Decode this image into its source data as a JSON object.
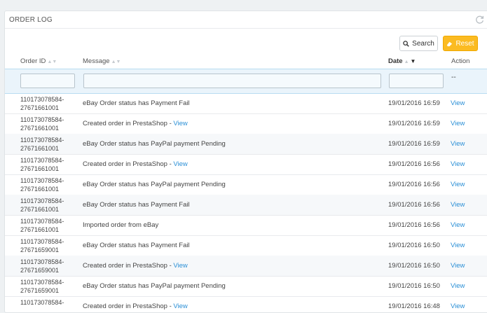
{
  "panel": {
    "title": "Order Log"
  },
  "toolbar": {
    "search_label": "Search",
    "reset_label": "Reset"
  },
  "columns": {
    "order_id": "Order ID",
    "message": "Message",
    "date": "Date",
    "action": "Action"
  },
  "filters": {
    "action_placeholder": "--"
  },
  "rows": [
    {
      "order_id": [
        "110173078584-",
        "27671661001"
      ],
      "message": "eBay Order status has Payment Fail",
      "link": "",
      "date": "19/01/2016 16:59",
      "action": "View"
    },
    {
      "order_id": [
        "110173078584-",
        "27671661001"
      ],
      "message": "Created order in PrestaShop - ",
      "link": "View",
      "date": "19/01/2016 16:59",
      "action": "View"
    },
    {
      "order_id": [
        "110173078584-",
        "27671661001"
      ],
      "message": "eBay Order status has PayPal payment Pending",
      "link": "",
      "date": "19/01/2016 16:59",
      "action": "View"
    },
    {
      "order_id": [
        "110173078584-",
        "27671661001"
      ],
      "message": "Created order in PrestaShop - ",
      "link": "View",
      "date": "19/01/2016 16:56",
      "action": "View"
    },
    {
      "order_id": [
        "110173078584-",
        "27671661001"
      ],
      "message": "eBay Order status has PayPal payment Pending",
      "link": "",
      "date": "19/01/2016 16:56",
      "action": "View"
    },
    {
      "order_id": [
        "110173078584-",
        "27671661001"
      ],
      "message": "eBay Order status has Payment Fail",
      "link": "",
      "date": "19/01/2016 16:56",
      "action": "View"
    },
    {
      "order_id": [
        "110173078584-",
        "27671661001"
      ],
      "message": "Imported order from eBay",
      "link": "",
      "date": "19/01/2016 16:56",
      "action": "View"
    },
    {
      "order_id": [
        "110173078584-",
        "27671659001"
      ],
      "message": "eBay Order status has Payment Fail",
      "link": "",
      "date": "19/01/2016 16:50",
      "action": "View"
    },
    {
      "order_id": [
        "110173078584-",
        "27671659001"
      ],
      "message": "Created order in PrestaShop - ",
      "link": "View",
      "date": "19/01/2016 16:50",
      "action": "View"
    },
    {
      "order_id": [
        "110173078584-",
        "27671659001"
      ],
      "message": "eBay Order status has PayPal payment Pending",
      "link": "",
      "date": "19/01/2016 16:50",
      "action": "View"
    },
    {
      "order_id": [
        "110173078584-",
        ""
      ],
      "message": "Created order in PrestaShop - ",
      "link": "View",
      "date": "19/01/2016 16:48",
      "action": "View"
    }
  ]
}
